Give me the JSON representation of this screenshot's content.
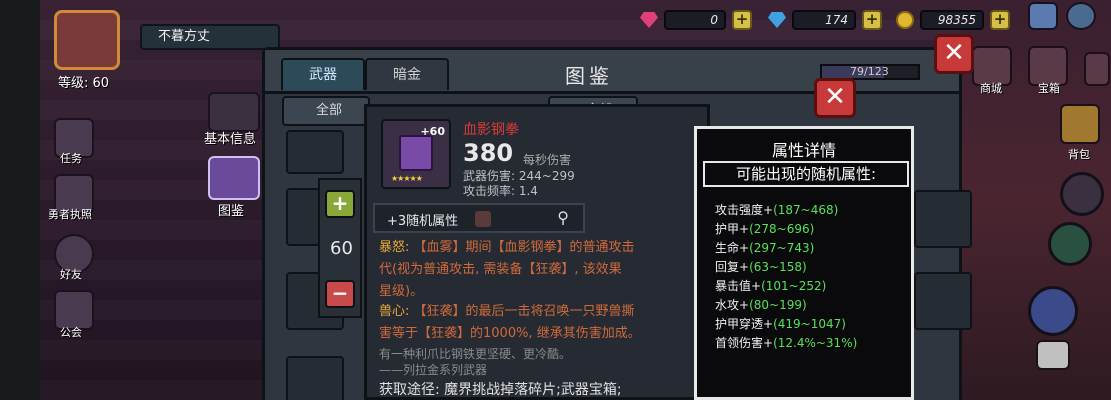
{
  "player": {
    "name": "不暮方丈",
    "level_text": "等级: 60"
  },
  "resources": [
    {
      "icon": "pink-gem-icon",
      "color": "#e0407a",
      "value": "0"
    },
    {
      "icon": "blue-diamond-icon",
      "color": "#40a0e0",
      "value": "174"
    },
    {
      "icon": "gold-coin-icon",
      "color": "#e0b830",
      "value": "98355"
    }
  ],
  "left_menu": {
    "basic_info": "基本信息",
    "encyclopedia": "图鉴",
    "tasks": "任务",
    "hero": "勇者执照",
    "friends": "好友",
    "guild": "公会"
  },
  "right_menu": {
    "shop": "商城",
    "treasure": "宝箱",
    "backpack": "背包"
  },
  "panel": {
    "title": "图鉴",
    "tabs": [
      "武器",
      "暗金"
    ],
    "active_tab": 0,
    "collection_progress": "79/123",
    "collection_fraction": 0.642,
    "filters": [
      "全部",
      "全部",
      "全部"
    ]
  },
  "weapon": {
    "name": "血影钢拳",
    "level": "+60",
    "stars": "★★★★★",
    "damage": "380",
    "damage_label": "每秒伤害",
    "damage_range": "武器伤害: 244~299",
    "attack_rate": "攻击频率: 1.4",
    "random_attrs": "+3随机属性",
    "desc_line1_tag": "暴怒:",
    "desc_line1": "【血雾】期间【血影钢拳】的普通攻击",
    "desc_line2": "代(视为普通攻击, 需装备【狂袭】, 该效果",
    "desc_line3": "星级)。",
    "desc_line4_tag": "兽心:",
    "desc_line4": "【狂袭】的最后一击将召唤一只野兽撕",
    "desc_line5": "害等于【狂袭】的1000%, 继承其伤害加成。",
    "flavor1": "有一种利爪比钢铁更坚硬、更冷酷。",
    "flavor2": "——列拉金系列武器",
    "source": "获取途径: 魔界挑战掉落碎片;武器宝箱;"
  },
  "stepper": {
    "value": "60",
    "plus": "+",
    "minus": "−"
  },
  "popup": {
    "title": "属性详情",
    "subtitle": "可能出现的随机属性:",
    "props": [
      {
        "name": "攻击强度+",
        "range": "(187~468)"
      },
      {
        "name": "护甲+",
        "range": "(278~696)"
      },
      {
        "name": "生命+",
        "range": "(297~743)"
      },
      {
        "name": "回复+",
        "range": "(63~158)"
      },
      {
        "name": "暴击值+",
        "range": "(101~252)"
      },
      {
        "name": "水攻+",
        "range": "(80~199)"
      },
      {
        "name": "护甲穿透+",
        "range": "(419~1047)"
      },
      {
        "name": "首领伤害+",
        "range": "(12.4%~31%)"
      }
    ]
  },
  "colors": {
    "accent_red": "#c83a3a",
    "weapon_name": "#d83a3a",
    "range_green": "#5ae05a"
  }
}
